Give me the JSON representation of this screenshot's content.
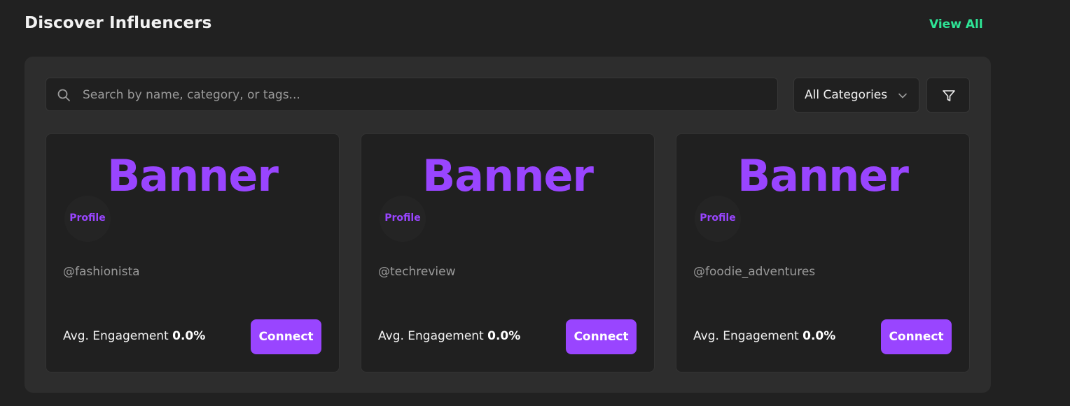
{
  "header": {
    "title": "Discover Influencers",
    "view_all": "View All"
  },
  "search": {
    "placeholder": "Search by name, category, or tags...",
    "value": ""
  },
  "category_filter": {
    "selected": "All Categories"
  },
  "cards": [
    {
      "banner": "Banner",
      "profile": "Profile",
      "handle": "@fashionista",
      "engagement_label": "Avg. Engagement",
      "engagement_value": "0.0%",
      "connect_label": "Connect"
    },
    {
      "banner": "Banner",
      "profile": "Profile",
      "handle": "@techreview",
      "engagement_label": "Avg. Engagement",
      "engagement_value": "0.0%",
      "connect_label": "Connect"
    },
    {
      "banner": "Banner",
      "profile": "Profile",
      "handle": "@foodie_adventures",
      "engagement_label": "Avg. Engagement",
      "engagement_value": "0.0%",
      "connect_label": "Connect"
    }
  ],
  "icons": {
    "search": "search-icon",
    "chevron": "chevron-down-icon",
    "filter": "filter-icon"
  },
  "colors": {
    "background": "#212121",
    "panel": "#2d2d2d",
    "card": "#202020",
    "accent_purple": "#9945ff",
    "accent_green": "#2ee596",
    "text_muted": "#9a9a9a"
  }
}
